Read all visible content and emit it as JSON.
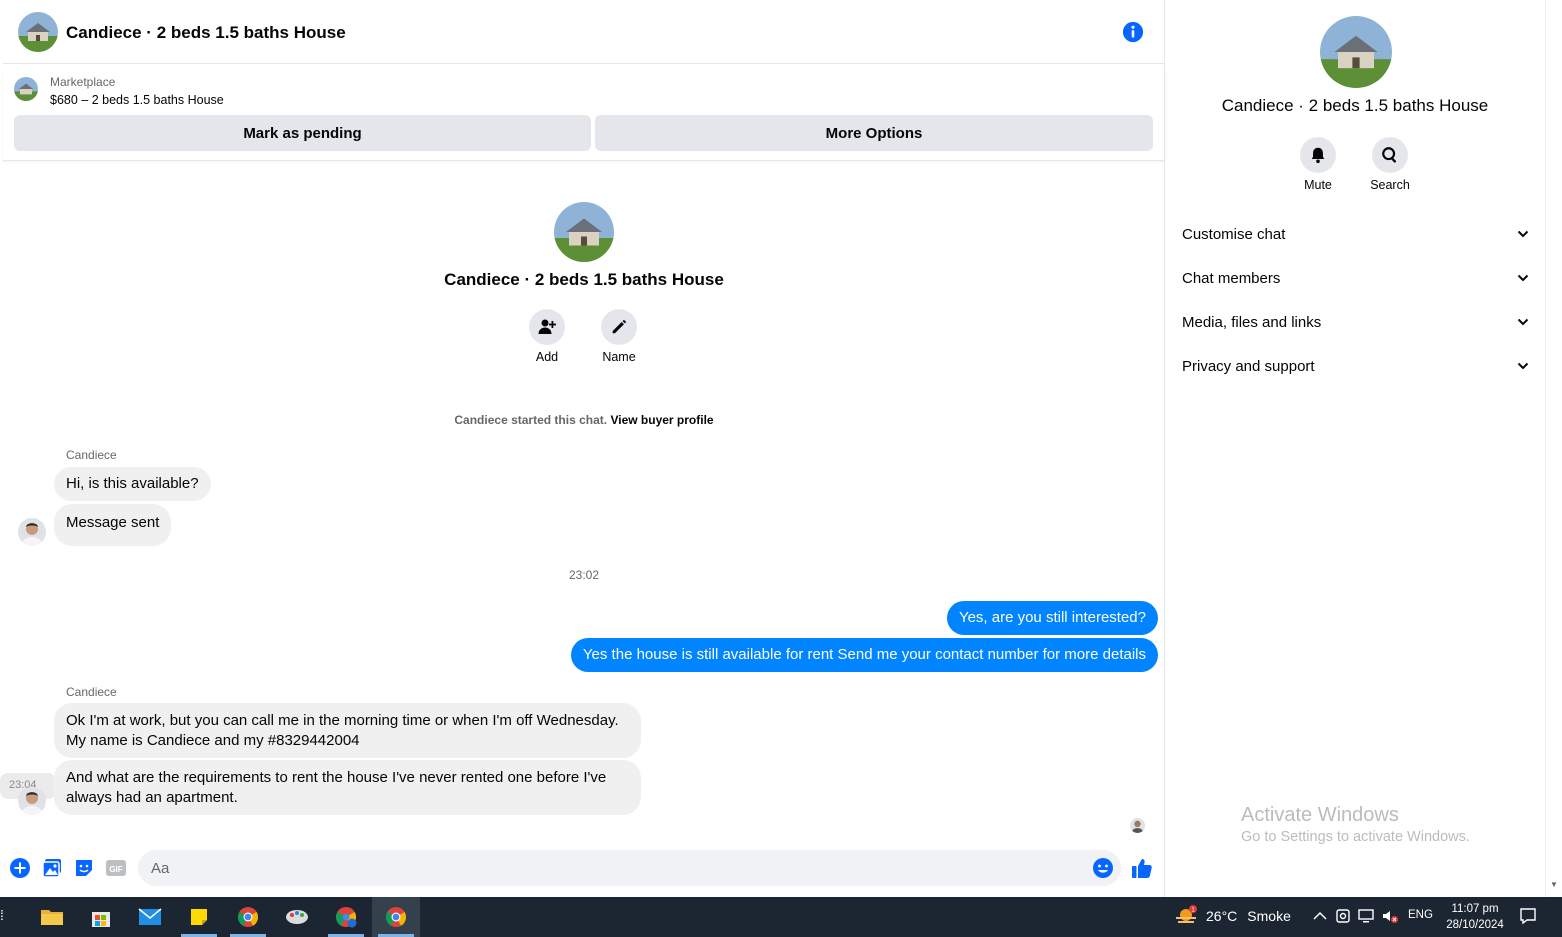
{
  "colors": {
    "accent": "#0084ff",
    "messenger_blue": "#0866ff",
    "bubble_in": "#f0f0f0",
    "taskbar": "#1c2632"
  },
  "header": {
    "title": "Candiece · 2 beds 1.5 baths House"
  },
  "listing": {
    "source": "Marketplace",
    "title": "$680 – 2 beds 1.5 baths House",
    "pending_label": "Mark as pending",
    "options_label": "More Options"
  },
  "intro": {
    "title": "Candiece · 2 beds 1.5 baths House",
    "add_label": "Add",
    "name_label": "Name",
    "started_text": "Candiece started this chat.",
    "profile_link": "View buyer profile"
  },
  "messages": {
    "group1_sender": "Candiece",
    "m1": "Hi, is this available?",
    "m2": "Message sent",
    "time_divider": "23:02",
    "m3": "Yes, are you still interested?",
    "m4": "Yes the house is still available for rent Send me your contact number for more details",
    "group2_sender": "Candiece",
    "m5_line1": "Ok I'm at work, but you can call me in the morning time or when I'm off Wednesday.",
    "m5_line2": "My name is Candiece and my #8329442004",
    "m6_line1": "And what are the requirements to rent the house I've never rented one before I've",
    "m6_line2": "always had an apartment.",
    "hover_time": "23:04"
  },
  "composer": {
    "placeholder": "Aa"
  },
  "panel": {
    "title": "Candiece · 2 beds 1.5 baths House",
    "mute_label": "Mute",
    "search_label": "Search",
    "rows": [
      "Customise chat",
      "Chat members",
      "Media, files and links",
      "Privacy and support"
    ]
  },
  "watermark": {
    "title": "Activate Windows",
    "subtitle": "Go to Settings to activate Windows."
  },
  "taskbar": {
    "weather_temp": "26°C",
    "weather_cond": "Smoke",
    "weather_badge": "1",
    "lang": "ENG",
    "time": "11:07 pm",
    "date": "28/10/2024",
    "apps": [
      "file-explorer-icon",
      "microsoft-store-icon",
      "mail-icon",
      "sticky-notes-icon",
      "chrome-icon",
      "paint-icon",
      "chrome-profile-icon",
      "chrome-icon"
    ]
  }
}
